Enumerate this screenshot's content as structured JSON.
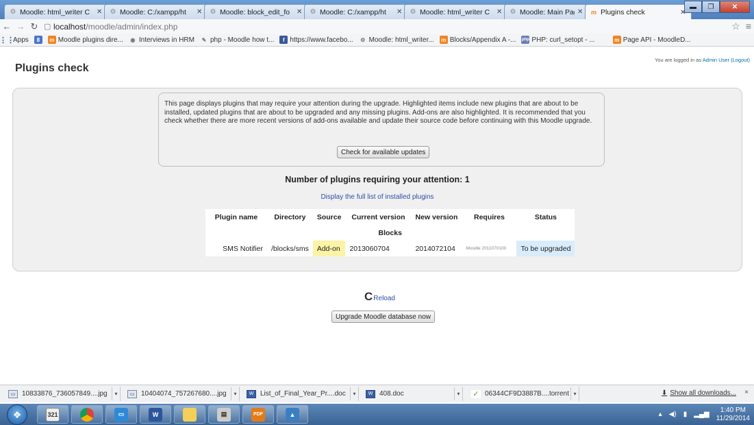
{
  "browser": {
    "tabs": [
      {
        "title": "Moodle: html_writer C",
        "icon": "moodle-gear-icon",
        "active": false
      },
      {
        "title": "Moodle: C:/xampp/ht",
        "icon": "moodle-gear-icon",
        "active": false
      },
      {
        "title": "Moodle: block_edit_fo",
        "icon": "moodle-gear-icon",
        "active": false
      },
      {
        "title": "Moodle: C:/xampp/ht",
        "icon": "moodle-gear-icon",
        "active": false
      },
      {
        "title": "Moodle: html_writer C",
        "icon": "moodle-gear-icon",
        "active": false
      },
      {
        "title": "Moodle: Main Page",
        "icon": "moodle-gear-icon",
        "active": false
      },
      {
        "title": "Plugins check",
        "icon": "moodle-m-icon",
        "active": true
      }
    ],
    "url_host": "localhost",
    "url_path": "/moodle/admin/index.php",
    "bookmarks": [
      {
        "label": "Apps",
        "icon": "apps-grid-icon"
      },
      {
        "label": "",
        "icon": "google-icon"
      },
      {
        "label": "Moodle plugins dire...",
        "icon": "moodle-m-icon"
      },
      {
        "label": "Interviews in HRM",
        "icon": "page-icon"
      },
      {
        "label": "php - Moodle how t...",
        "icon": "page-icon"
      },
      {
        "label": "https://www.facebo...",
        "icon": "facebook-icon"
      },
      {
        "label": "Moodle: html_writer...",
        "icon": "moodle-gear-icon"
      },
      {
        "label": "Blocks/Appendix A -...",
        "icon": "moodle-m-icon"
      },
      {
        "label": "PHP: curl_setopt - ...",
        "icon": "php-icon"
      },
      {
        "label": "Page API - MoodleD...",
        "icon": "moodle-m-icon"
      }
    ]
  },
  "page": {
    "title": "Plugins check",
    "login_text": "You are logged in as ",
    "login_user": "Admin User",
    "logout": "(Logout)",
    "info_text": "This page displays plugins that may require your attention during the upgrade. Highlighted items include new plugins that are about to be installed, updated plugins that are about to be upgraded and any missing plugins. Add-ons are also highlighted. It is recommended that you check whether there are more recent versions of add-ons available and update their source code before continuing with this Moodle upgrade.",
    "check_updates_button": "Check for available updates",
    "attention_heading": "Number of plugins requiring your attention: 1",
    "full_list_link": "Display the full list of installed plugins",
    "table": {
      "headers": [
        "Plugin name",
        "Directory",
        "Source",
        "Current version",
        "New version",
        "Requires",
        "Status"
      ],
      "group": "Blocks",
      "rows": [
        {
          "name": "SMS Notifier",
          "directory": "/blocks/sms",
          "source": "Add-on",
          "current": "2013060704",
          "new": "2014072104",
          "requires": "Moodle 2011070100",
          "status": "To be upgraded"
        }
      ]
    },
    "reload_label": "Reload",
    "upgrade_button": "Upgrade Moodle database now"
  },
  "downloads": {
    "items": [
      {
        "name": "10833876_736057849....jpg",
        "type": "image"
      },
      {
        "name": "10404074_757267680....jpg",
        "type": "image"
      },
      {
        "name": "List_of_Final_Year_Pr....doc",
        "type": "doc"
      },
      {
        "name": "408.doc",
        "type": "doc"
      },
      {
        "name": "06344CF9D3887B....torrent",
        "type": "torrent"
      }
    ],
    "show_all": "Show all downloads...",
    "close": "×"
  },
  "taskbar": {
    "calendar_day": "321",
    "time": "1:40 PM",
    "date": "11/29/2014",
    "apps": [
      "calendar-icon",
      "chrome-icon",
      "desktop-icon",
      "word-icon",
      "folder-icon",
      "notepad-icon",
      "pdf-icon",
      "picture-icon"
    ]
  },
  "colors": {
    "addon_highlight": "#fbf3a6",
    "status_highlight": "#d9ecfb",
    "link": "#2b50a6"
  }
}
